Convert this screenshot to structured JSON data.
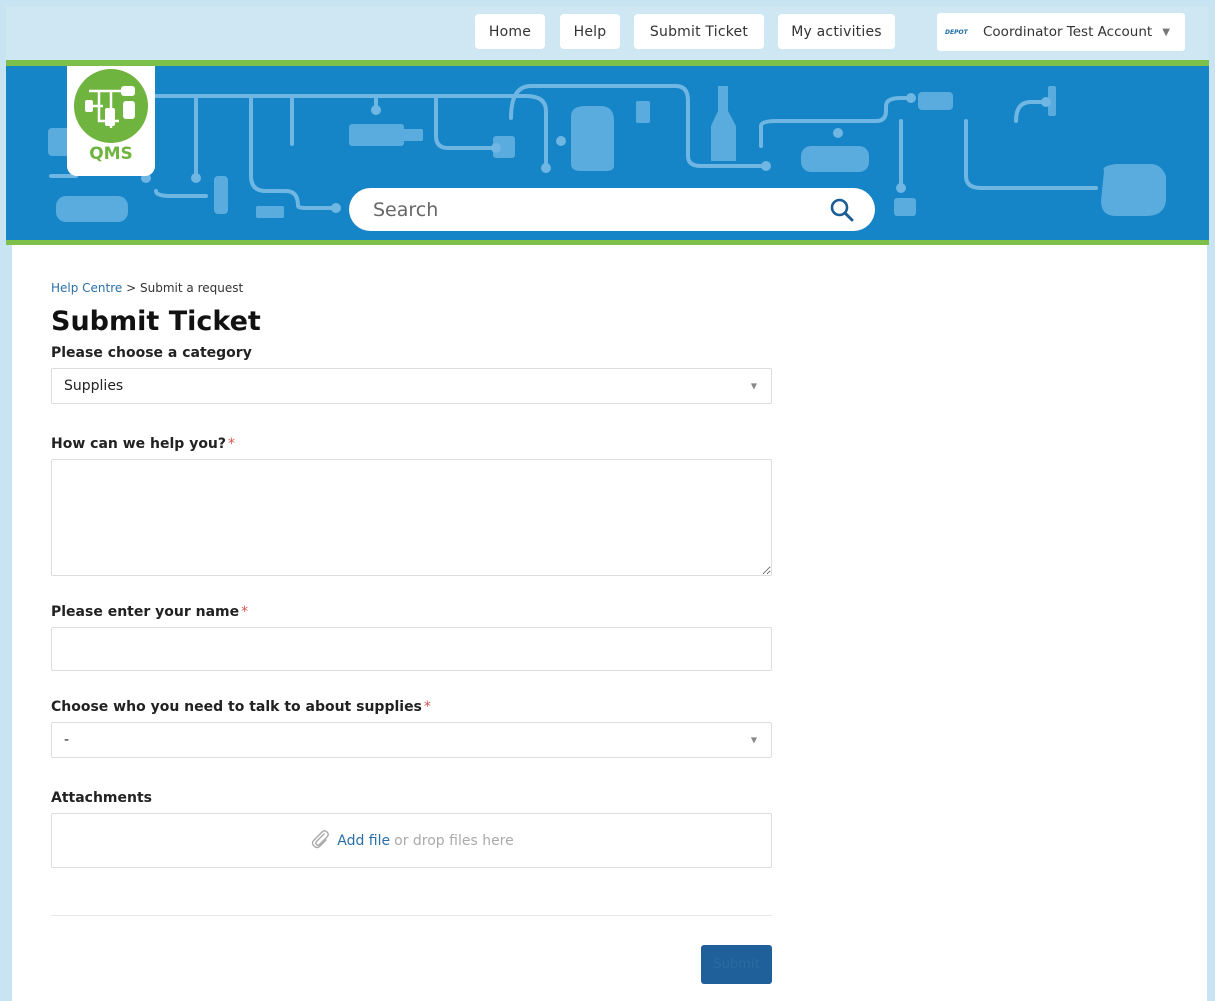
{
  "nav": {
    "home": "Home",
    "help": "Help",
    "submit_ticket": "Submit Ticket",
    "my_activities": "My activities",
    "account_name": "Coordinator Test Account",
    "account_logo_text": "DEPOT"
  },
  "logo": {
    "text": "QMS"
  },
  "search": {
    "placeholder": "Search"
  },
  "breadcrumb": {
    "home": "Help Centre",
    "separator": ">",
    "current": "Submit a request"
  },
  "page": {
    "title": "Submit Ticket"
  },
  "form": {
    "category_label": "Please choose a category",
    "category_value": "Supplies",
    "description_label": "How can we help you?",
    "name_label": "Please enter your name",
    "contact_label": "Choose who you need to talk to about supplies",
    "contact_value": "-",
    "required_mark": "*",
    "attachments_label": "Attachments",
    "add_file": "Add file",
    "drop_text": "or drop files here",
    "submit": "Submit"
  },
  "colors": {
    "banner": "#1585c7",
    "accent_green": "#7cbf4a",
    "link": "#2a6fa8",
    "submit_bg": "#1f5f9a"
  }
}
